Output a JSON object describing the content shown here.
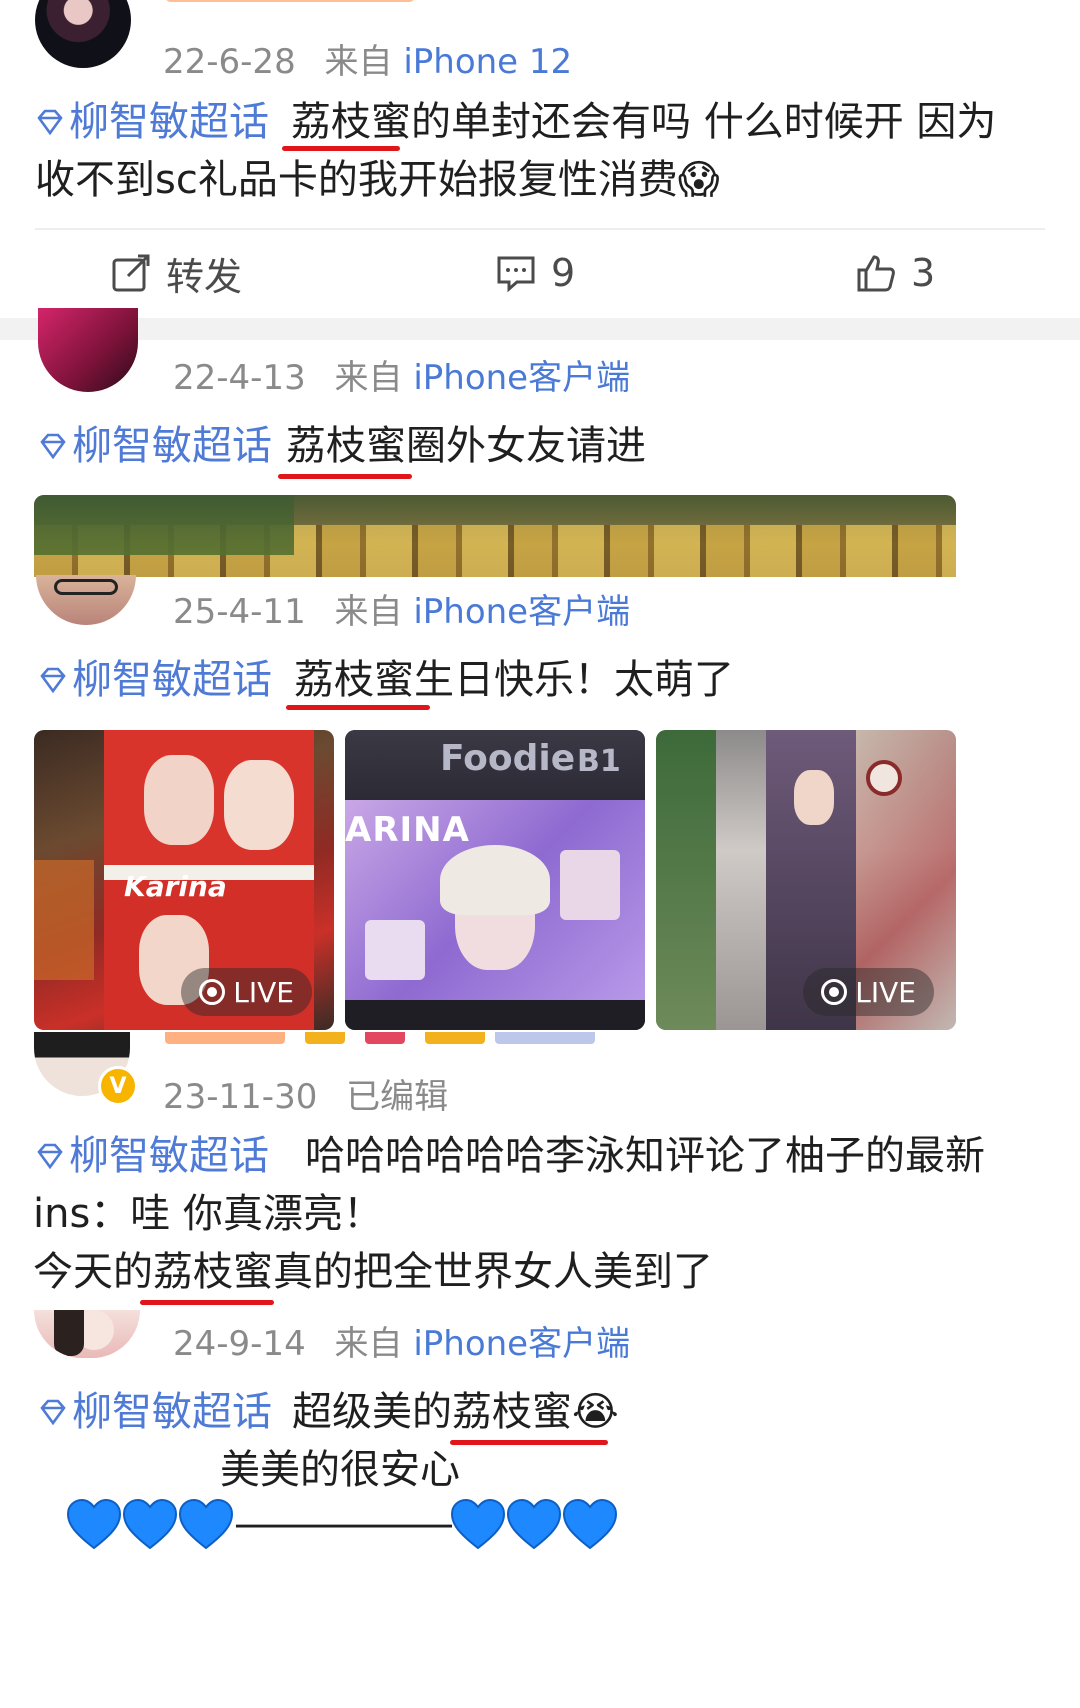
{
  "posts": [
    {
      "date": "22-6-28",
      "from_label": "来自",
      "source": "iPhone 12",
      "topic": "柳智敏超话",
      "body_line1": "荔枝蜜的单封还会有吗 什么时候开 因为",
      "body_line2": "收不到sc礼品卡的我开始报复性消费",
      "emoji": "😱",
      "actions": {
        "repost_label": "转发",
        "comment_count": "9",
        "like_count": "3"
      }
    },
    {
      "date": "22-4-13",
      "from_label": "来自",
      "source": "iPhone客户端",
      "topic": "柳智敏超话",
      "body_line1": "荔枝蜜圈外女友请进"
    },
    {
      "date": "25-4-11",
      "from_label": "来自",
      "source": "iPhone客户端",
      "topic": "柳智敏超话",
      "body_line1": "荔枝蜜生日快乐！太萌了",
      "photos": [
        {
          "overlay": "LIVE",
          "sign_text": "Karina"
        },
        {
          "sign_text": "Foodie",
          "sign_text2": "B1",
          "screen_text": "ARINA"
        },
        {
          "overlay": "LIVE"
        }
      ]
    },
    {
      "date": "23-11-30",
      "edited_label": "已编辑",
      "topic": "柳智敏超话",
      "body_line1": "哈哈哈哈哈哈李泳知评论了柚子的最新",
      "body_line2": "ins：哇 你真漂亮！",
      "body_line3": "今天的荔枝蜜真的把全世界女人美到了",
      "verified_badge": "V"
    },
    {
      "date": "24-9-14",
      "from_label": "来自",
      "source": "iPhone客户端",
      "topic": "柳智敏超话",
      "body_line1": "超级美的荔枝蜜",
      "emoji": "😭",
      "body_line2": "美美的很安心",
      "heart_row_dashes": "——————"
    }
  ],
  "colors": {
    "topic_blue": "#4f7bd6",
    "underline_red": "#e0161a",
    "meta_gray": "#8a8a8a",
    "heart_blue": "#1e88ff"
  }
}
